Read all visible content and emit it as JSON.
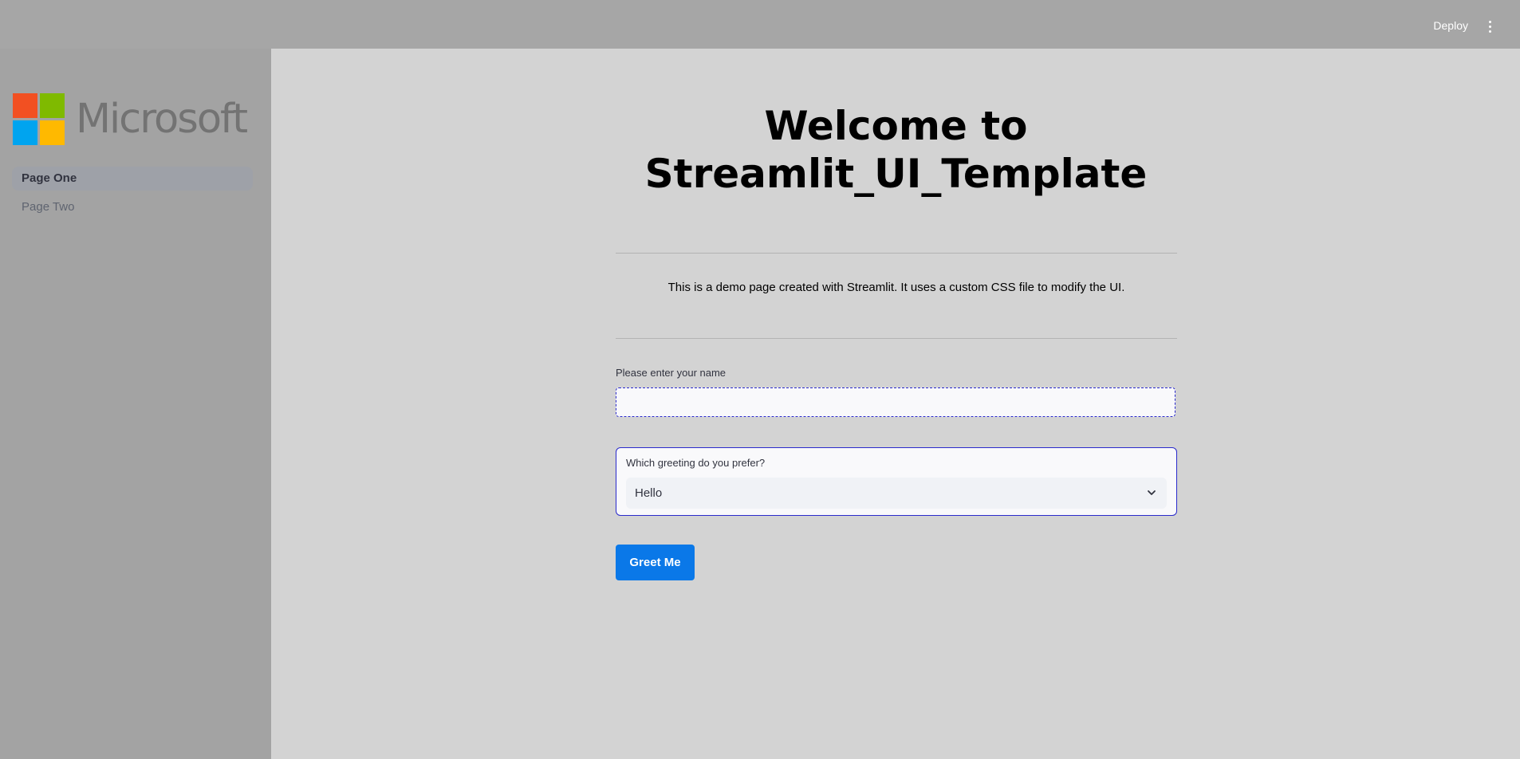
{
  "header": {
    "deploy_label": "Deploy",
    "menu_icon": "kebab-menu-icon"
  },
  "sidebar": {
    "logo": {
      "text": "Microsoft",
      "icon": "microsoft-logo-icon",
      "colors": [
        "#f25022",
        "#7fba00",
        "#00a4ef",
        "#ffb900"
      ]
    },
    "items": [
      {
        "label": "Page One",
        "active": true
      },
      {
        "label": "Page Two",
        "active": false
      }
    ]
  },
  "main": {
    "title_line1": "Welcome to",
    "title_line2": "Streamlit_UI_Template",
    "description": "This is a demo page created with Streamlit. It uses a custom CSS file to modify the UI.",
    "name_input": {
      "label": "Please enter your name",
      "value": ""
    },
    "greeting_select": {
      "label": "Which greeting do you prefer?",
      "selected": "Hello",
      "icon": "chevron-down-icon"
    },
    "greet_button_label": "Greet Me"
  },
  "colors": {
    "header_bg": "#a6a6a6",
    "sidebar_bg": "#a3a3a3",
    "main_bg": "#d3d3d3",
    "accent": "#0a78e8",
    "focus_border": "#2a2acc"
  }
}
